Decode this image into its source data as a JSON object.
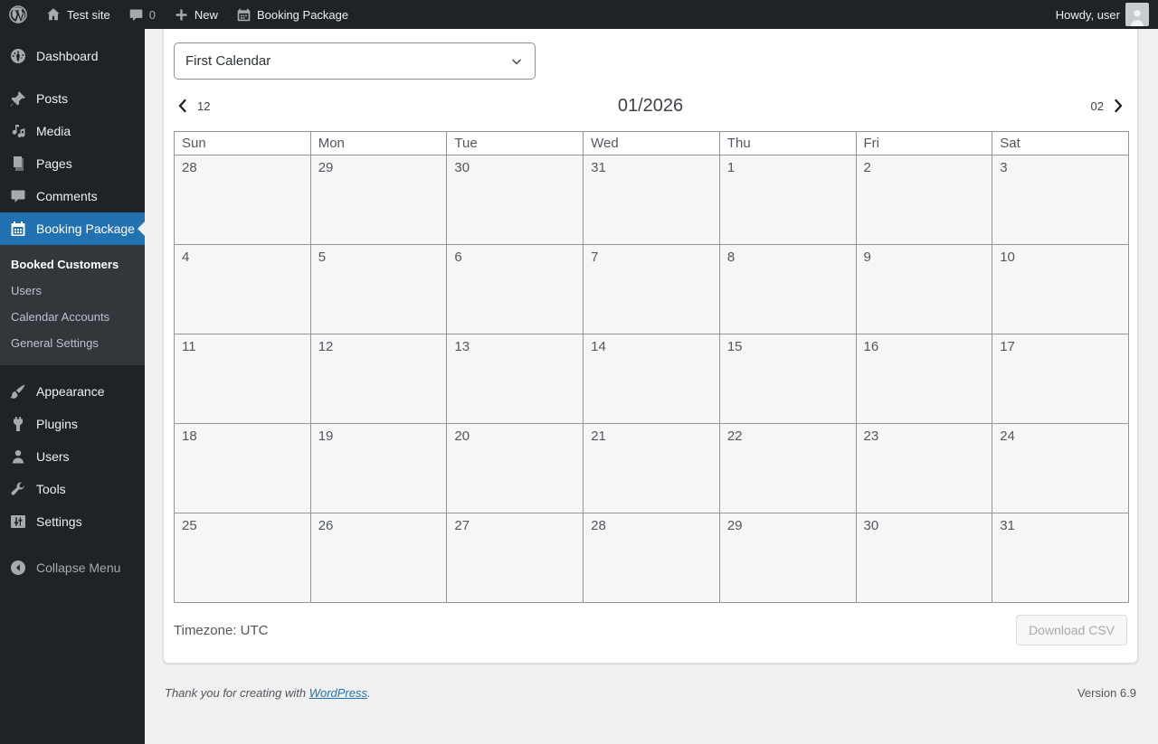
{
  "admin_bar": {
    "site_name": "Test site",
    "comments_count": "0",
    "new_label": "New",
    "plugin_shortcut_label": "Booking Package",
    "howdy": "Howdy, user"
  },
  "sidebar": {
    "items": [
      {
        "label": "Dashboard",
        "icon": "dashboard-icon"
      },
      {
        "label": "Posts",
        "icon": "pin-icon",
        "sep_before": true
      },
      {
        "label": "Media",
        "icon": "media-icon"
      },
      {
        "label": "Pages",
        "icon": "pages-icon"
      },
      {
        "label": "Comments",
        "icon": "comments-icon"
      },
      {
        "label": "Booking Package",
        "icon": "calendar-icon",
        "active": true,
        "submenu": [
          {
            "label": "Booked Customers",
            "current": true
          },
          {
            "label": "Users"
          },
          {
            "label": "Calendar Accounts"
          },
          {
            "label": "General Settings"
          }
        ]
      },
      {
        "label": "Appearance",
        "icon": "brush-icon",
        "sep_before": true
      },
      {
        "label": "Plugins",
        "icon": "plugin-icon"
      },
      {
        "label": "Users",
        "icon": "user-icon"
      },
      {
        "label": "Tools",
        "icon": "wrench-icon"
      },
      {
        "label": "Settings",
        "icon": "sliders-icon"
      },
      {
        "label": "Collapse Menu",
        "icon": "collapse-icon",
        "collapse": true,
        "sep_before": true
      }
    ]
  },
  "calendar": {
    "selected_calendar": "First Calendar",
    "prev_month": "12",
    "next_month": "02",
    "title": "01/2026",
    "weekdays": [
      "Sun",
      "Mon",
      "Tue",
      "Wed",
      "Thu",
      "Fri",
      "Sat"
    ],
    "weeks": [
      [
        "28",
        "29",
        "30",
        "31",
        "1",
        "2",
        "3"
      ],
      [
        "4",
        "5",
        "6",
        "7",
        "8",
        "9",
        "10"
      ],
      [
        "11",
        "12",
        "13",
        "14",
        "15",
        "16",
        "17"
      ],
      [
        "18",
        "19",
        "20",
        "21",
        "22",
        "23",
        "24"
      ],
      [
        "25",
        "26",
        "27",
        "28",
        "29",
        "30",
        "31"
      ]
    ],
    "timezone_label": "Timezone: UTC",
    "download_csv_label": "Download CSV"
  },
  "footer": {
    "thanks_prefix": "Thank you for creating with ",
    "wordpress_link_label": "WordPress",
    "thanks_suffix": ".",
    "version": "Version 6.9"
  },
  "colors": {
    "accent_blue": "#2271b1",
    "admin_dark": "#1d2327",
    "submenu_bg": "#32373c",
    "page_bg": "#f0f0f1",
    "cell_bg": "#f6f6f6",
    "grid_border": "#949494"
  }
}
